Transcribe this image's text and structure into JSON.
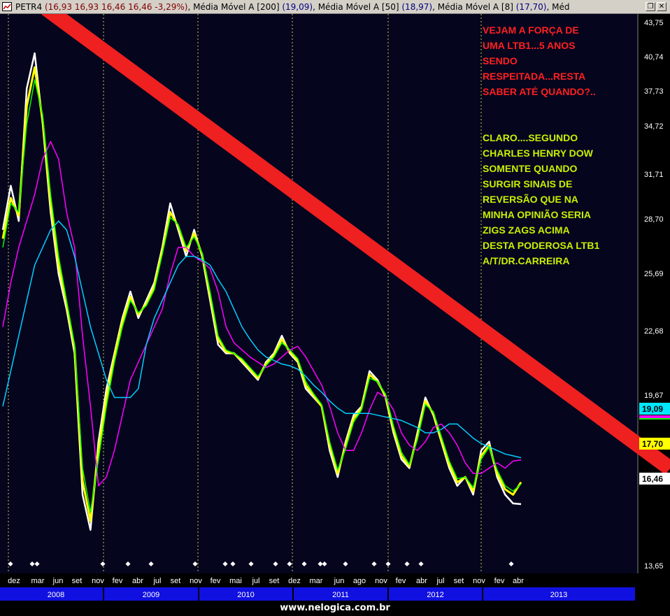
{
  "window": {
    "title_segments": [
      {
        "text": "PETR4 ",
        "color": "#000000"
      },
      {
        "text": "(16,93  16,93  16,46  16,46  -3,29%)",
        "color": "#800000"
      },
      {
        "text": ", Média Móvel A [200] ",
        "color": "#000000"
      },
      {
        "text": "(19,09)",
        "color": "#000080"
      },
      {
        "text": ", Média Móvel A [50] ",
        "color": "#000000"
      },
      {
        "text": "(18,97)",
        "color": "#000080"
      },
      {
        "text": ", Média Móvel A [8] ",
        "color": "#000000"
      },
      {
        "text": "(17,70)",
        "color": "#000080"
      },
      {
        "text": ", Méd",
        "color": "#000000"
      }
    ],
    "restore_icon": "restore-icon",
    "close_icon": "close-icon"
  },
  "annotation": {
    "red_lines": [
      "VEJAM A FORÇA DE",
      "UMA LTB1...5 ANOS",
      "SENDO",
      "RESPEITADA...RESTA",
      "SABER ATÉ QUANDO?.."
    ],
    "green_lines": [
      "CLARO....SEGUNDO",
      "CHARLES HENRY DOW",
      "SOMENTE QUANDO",
      "SURGIR SINAIS DE",
      "REVERSÃO QUE NA",
      "MINHA OPINIÃO SERIA",
      "ZIGS ZAGS ACIMA",
      "DESTA PODEROSA LTB1",
      "A/T/DR.CARREIRA"
    ],
    "red_color": "#ff2020",
    "green_color": "#c8f000"
  },
  "footer": {
    "text": "www.nelogica.com.br"
  },
  "chart_data": {
    "type": "line",
    "ticker": "PETR4",
    "y_ticks": [
      "43,75",
      "40,74",
      "37,73",
      "34,72",
      "31,71",
      "28,70",
      "25,69",
      "22,68",
      "19,67",
      "13,65"
    ],
    "ylim": [
      13.65,
      43.75
    ],
    "month_labels": [
      "dez",
      "mar",
      "jun",
      "set",
      "nov",
      "fev",
      "abr",
      "jul",
      "set",
      "nov",
      "fev",
      "mai",
      "jul",
      "set",
      "dez",
      "mar",
      "jun",
      "ago",
      "nov",
      "fev",
      "abr",
      "jul",
      "set",
      "nov",
      "fev",
      "abr"
    ],
    "year_labels": [
      "2008",
      "2009",
      "2010",
      "2011",
      "2012",
      "2013"
    ],
    "price_tags": [
      {
        "label": "19,09",
        "bg": "#00e8ff",
        "fg": "#000000"
      },
      {
        "label": "17,70",
        "bg": "#ffff00",
        "fg": "#000000"
      },
      {
        "label": "16,46",
        "bg": "#ffffff",
        "fg": "#000000"
      }
    ],
    "trendline": {
      "name": "LTB1",
      "start": {
        "x": "2008-01",
        "y": 44.5
      },
      "end": {
        "x": "2013-05",
        "y": 16.5
      },
      "color": "#ee2020"
    },
    "x": [
      "2007-12",
      "2008-01",
      "2008-02",
      "2008-03",
      "2008-04",
      "2008-05",
      "2008-06",
      "2008-07",
      "2008-08",
      "2008-09",
      "2008-10",
      "2008-11",
      "2008-12",
      "2009-01",
      "2009-02",
      "2009-03",
      "2009-04",
      "2009-05",
      "2009-06",
      "2009-07",
      "2009-08",
      "2009-09",
      "2009-10",
      "2009-11",
      "2009-12",
      "2010-01",
      "2010-02",
      "2010-03",
      "2010-04",
      "2010-05",
      "2010-06",
      "2010-07",
      "2010-08",
      "2010-09",
      "2010-10",
      "2010-11",
      "2010-12",
      "2011-01",
      "2011-02",
      "2011-03",
      "2011-04",
      "2011-05",
      "2011-06",
      "2011-07",
      "2011-08",
      "2011-09",
      "2011-10",
      "2011-11",
      "2011-12",
      "2012-01",
      "2012-02",
      "2012-03",
      "2012-04",
      "2012-05",
      "2012-06",
      "2012-07",
      "2012-08",
      "2012-09",
      "2012-10",
      "2012-11",
      "2012-12",
      "2013-01",
      "2013-02",
      "2013-03",
      "2013-04",
      "2013-05"
    ],
    "series": [
      {
        "name": "PETR4",
        "color": "#ffffff",
        "values": [
          32.0,
          34.5,
          32.5,
          40.0,
          42.0,
          38.0,
          33.0,
          29.5,
          27.5,
          25.0,
          17.0,
          15.0,
          20.0,
          23.0,
          25.0,
          27.0,
          28.5,
          27.0,
          28.0,
          29.0,
          31.0,
          33.5,
          32.0,
          30.5,
          32.0,
          30.5,
          28.0,
          25.5,
          25.0,
          25.0,
          24.5,
          24.0,
          23.5,
          24.5,
          25.0,
          26.0,
          25.0,
          24.5,
          23.0,
          22.5,
          22.0,
          19.5,
          18.0,
          20.0,
          21.5,
          22.0,
          24.0,
          23.5,
          22.5,
          20.5,
          19.0,
          18.5,
          20.5,
          22.5,
          21.5,
          20.0,
          18.5,
          17.5,
          18.0,
          17.0,
          19.5,
          20.0,
          18.0,
          17.0,
          16.5,
          16.46
        ]
      },
      {
        "name": "Média Móvel A [8]",
        "color": "#ffff00",
        "values": [
          31.5,
          33.8,
          32.8,
          39.0,
          41.2,
          38.2,
          33.5,
          30.0,
          27.8,
          25.3,
          17.8,
          15.5,
          19.5,
          22.5,
          24.8,
          26.8,
          28.2,
          27.2,
          27.8,
          28.8,
          30.8,
          33.0,
          32.2,
          30.8,
          31.8,
          30.6,
          28.3,
          25.8,
          25.1,
          25.0,
          24.6,
          24.1,
          23.6,
          24.4,
          24.9,
          25.8,
          25.1,
          24.6,
          23.2,
          22.6,
          22.0,
          19.8,
          18.2,
          19.8,
          21.3,
          21.9,
          23.8,
          23.4,
          22.6,
          20.7,
          19.2,
          18.6,
          20.3,
          22.3,
          21.6,
          20.1,
          18.7,
          17.7,
          18.0,
          17.2,
          19.2,
          19.8,
          18.2,
          17.3,
          17.0,
          17.7
        ]
      },
      {
        "name": "Média Móvel A [50]",
        "color": "#ff00ff",
        "values": [
          26.5,
          29.0,
          31.0,
          32.5,
          34.0,
          36.0,
          37.0,
          36.0,
          33.0,
          31.0,
          26.0,
          22.0,
          17.5,
          18.0,
          19.5,
          21.5,
          23.5,
          24.5,
          25.5,
          26.5,
          27.5,
          29.5,
          31.0,
          31.0,
          30.5,
          30.2,
          29.8,
          28.5,
          26.5,
          25.6,
          25.2,
          24.8,
          24.5,
          24.2,
          24.4,
          24.8,
          25.2,
          25.4,
          24.8,
          24.0,
          23.2,
          22.0,
          20.5,
          19.5,
          19.5,
          20.5,
          21.8,
          22.8,
          22.5,
          21.8,
          20.5,
          19.8,
          19.5,
          20.0,
          20.8,
          21.0,
          20.5,
          19.8,
          18.8,
          18.2,
          18.2,
          18.5,
          18.8,
          18.5,
          18.9,
          18.97
        ]
      },
      {
        "name": "Média Móvel A [200]",
        "color": "#00d0ff",
        "values": [
          22.0,
          24.0,
          26.0,
          28.0,
          30.0,
          31.0,
          32.0,
          32.5,
          32.0,
          30.5,
          28.5,
          26.5,
          25.0,
          23.5,
          22.5,
          22.5,
          22.5,
          23.0,
          25.5,
          27.0,
          28.0,
          29.0,
          30.0,
          30.5,
          30.5,
          30.3,
          30.0,
          29.2,
          28.5,
          27.5,
          26.5,
          25.8,
          25.2,
          24.8,
          24.6,
          24.4,
          24.3,
          24.1,
          23.7,
          23.2,
          22.8,
          22.3,
          21.9,
          21.6,
          21.6,
          21.6,
          21.6,
          21.5,
          21.4,
          21.3,
          21.2,
          21.0,
          20.8,
          20.5,
          20.5,
          20.7,
          21.0,
          21.0,
          20.6,
          20.2,
          19.9,
          19.7,
          19.5,
          19.3,
          19.2,
          19.09
        ]
      },
      {
        "name": "Média Móvel A",
        "color": "#00ff00",
        "values": [
          31.0,
          33.5,
          33.0,
          38.0,
          40.5,
          38.5,
          34.0,
          30.5,
          28.0,
          25.5,
          18.5,
          16.0,
          19.0,
          22.0,
          24.5,
          26.5,
          28.0,
          27.3,
          27.7,
          28.6,
          30.6,
          32.7,
          32.3,
          31.0,
          31.6,
          30.7,
          28.5,
          26.0,
          25.2,
          25.0,
          24.7,
          24.2,
          23.7,
          24.3,
          24.8,
          25.6,
          25.2,
          24.7,
          23.4,
          22.7,
          22.1,
          20.0,
          18.4,
          19.6,
          21.1,
          21.8,
          23.6,
          23.4,
          22.7,
          20.9,
          19.4,
          18.7,
          20.1,
          22.1,
          21.7,
          20.3,
          18.9,
          17.9,
          18.0,
          17.4,
          19.0,
          19.7,
          18.4,
          17.5,
          17.2,
          17.6
        ]
      }
    ],
    "grid": true,
    "legend": "top"
  }
}
